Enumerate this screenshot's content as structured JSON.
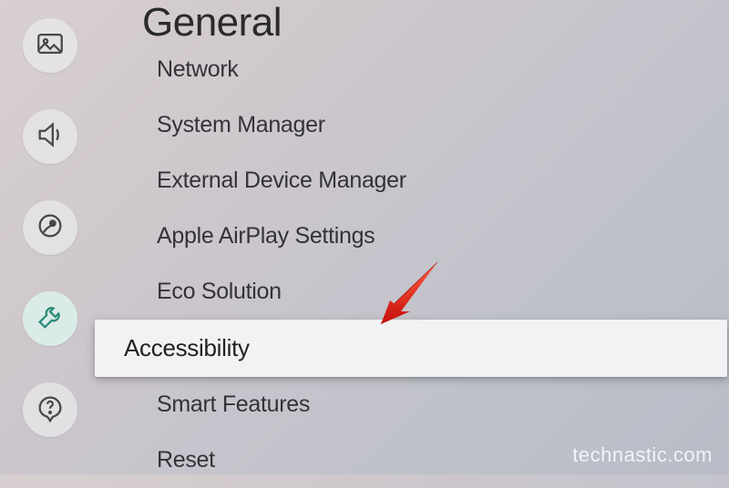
{
  "page": {
    "title": "General"
  },
  "sidebar": {
    "items": [
      {
        "name": "picture",
        "active": false
      },
      {
        "name": "sound",
        "active": false
      },
      {
        "name": "broadcasting",
        "active": false
      },
      {
        "name": "general",
        "active": true
      },
      {
        "name": "support",
        "active": false
      }
    ]
  },
  "menu": {
    "items": [
      {
        "label": "Network",
        "selected": false,
        "partial": true
      },
      {
        "label": "System Manager",
        "selected": false
      },
      {
        "label": "External Device Manager",
        "selected": false
      },
      {
        "label": "Apple AirPlay Settings",
        "selected": false
      },
      {
        "label": "Eco Solution",
        "selected": false
      },
      {
        "label": "Accessibility",
        "selected": true
      },
      {
        "label": "Smart Features",
        "selected": false
      },
      {
        "label": "Reset",
        "selected": false
      }
    ]
  },
  "annotation": {
    "arrow_color": "#e3211a"
  },
  "watermark": "technastic.com"
}
